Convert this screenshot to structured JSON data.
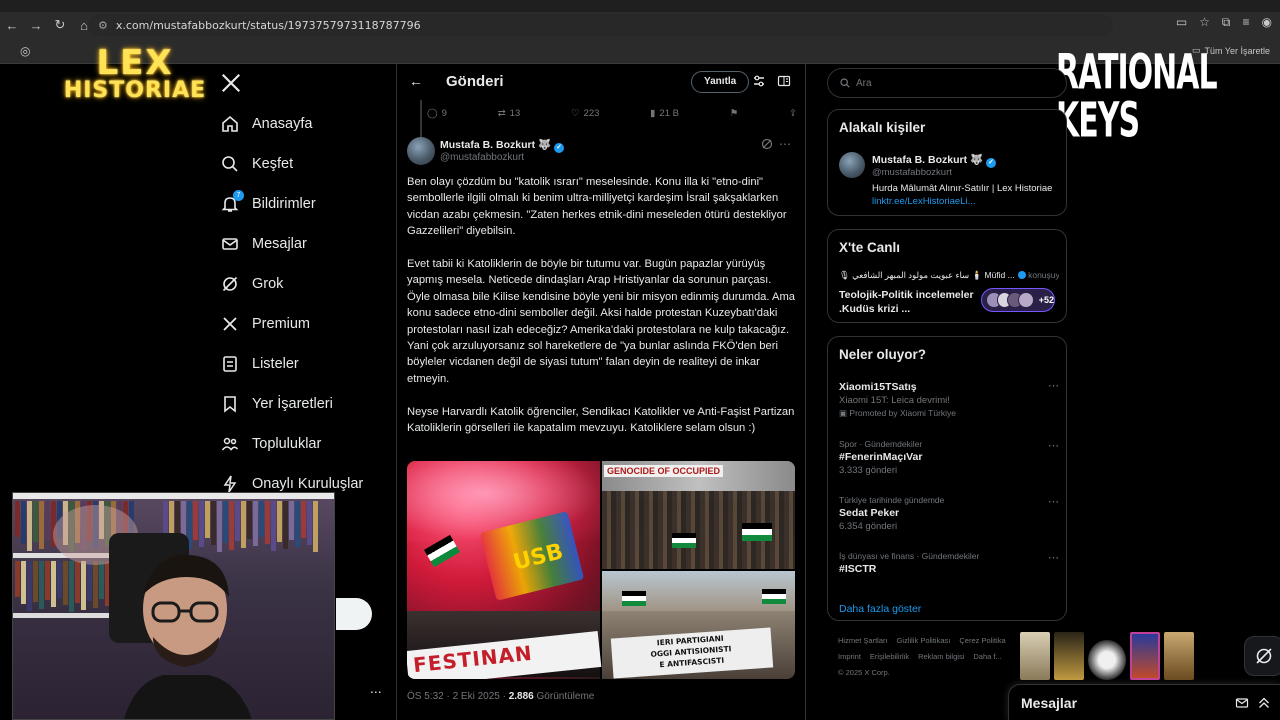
{
  "browser": {
    "url": "x.com/mustafabbozkurt/status/1973757973118787796",
    "bookmark_label": "Tüm Yer İşaretle"
  },
  "logos": {
    "lex_line1": "LEX",
    "lex_line2": "HISTORIAE",
    "rational_keys": "RATIONAL KEYS"
  },
  "nav": {
    "items": [
      {
        "label": "Anasayfa",
        "icon": "home-icon"
      },
      {
        "label": "Keşfet",
        "icon": "search-icon"
      },
      {
        "label": "Bildirimler",
        "icon": "bell-icon"
      },
      {
        "label": "Mesajlar",
        "icon": "mail-icon"
      },
      {
        "label": "Grok",
        "icon": "grok-icon"
      },
      {
        "label": "Premium",
        "icon": "x-icon"
      },
      {
        "label": "Listeler",
        "icon": "list-icon"
      },
      {
        "label": "Yer İşaretleri",
        "icon": "bookmark-icon"
      },
      {
        "label": "Topluluklar",
        "icon": "people-icon"
      },
      {
        "label": "Onaylı Kuruluşlar",
        "icon": "bolt-icon"
      }
    ],
    "notif_badge": "7",
    "bottom_more": "..."
  },
  "header": {
    "title": "Gönderi",
    "reply_label": "Yanıtla"
  },
  "prev_actions": {
    "replies": "9",
    "reposts": "13",
    "likes": "223",
    "views": "21 B"
  },
  "post": {
    "author_name": "Mustafa B. Bozkurt",
    "author_flag": "🐺",
    "author_handle": "@mustafabbozkurt",
    "paragraphs": [
      "Ben olayı çözdüm bu \"katolik ısrarı\" meselesinde. Konu illa ki \"etno-dini\" sembollerle ilgili olmalı ki benim ultra-milliyetçi kardeşim İsrail şakşaklarken vicdan azabı çekmesin. \"Zaten herkes etnik-dini meseleden ötürü destekliyor Gazzelileri\" diyebilsin.",
      "Evet tabii ki Katoliklerin de böyle bir tutumu var. Bugün papazlar yürüyüş yapmış mesela. Neticede dindaşları Arap Hristiyanlar da sorunun parçası. Öyle olmasa bile Kilise kendisine böyle yeni bir misyon edinmiş durumda. Ama konu sadece etno-dini semboller değil. Aksi halde protestan Kuzeybatı'daki protestoları nasıl izah edeceğiz? Amerika'daki protestolara ne kulp takacağız. Yani çok arzuluyorsanız sol hareketlere de \"ya bunlar aslında FKÖ'den beri böyleler vicdanen değil de siyasi tutum\" falan deyin de realiteyi de inkar etmeyin.",
      "Neyse Harvardlı Katolik  öğrenciler, Sendikacı Katolikler ve Anti-Faşist Partizan Katoliklerin görselleri ile kapatalım mevzuyu. Katoliklere selam olsun :)"
    ],
    "image_texts": {
      "img1_banner": "FESTINAN",
      "img1_flag": "USB",
      "img2_sign": "GENOCIDE  OF OCCUPIED",
      "img3_banner_l1": "IERI PARTIGIANI",
      "img3_banner_l2": "OGGI ANTISIONISTI",
      "img3_banner_l3": "E ANTIFASCISTI"
    },
    "time": "ÖS 5:32 · 2 Eki 2025 · ",
    "views_count": "2.886",
    "views_label": " Görüntüleme"
  },
  "right": {
    "search_placeholder": "Ara",
    "related": {
      "title": "Alakalı kişiler",
      "name": "Mustafa B. Bozkurt",
      "flag": "🐺",
      "handle": "@mustafabbozkurt",
      "bio": "Hurda Mâlumât Alınır-Satılır | Lex Historiae ",
      "bio_link": "linktr.ee/LexHistoriaeLi..."
    },
    "live": {
      "title": "X'te Canlı",
      "host": "🎙 ساء عبويت مولود المبهر الشافعي 🕯️ Müfid ...",
      "speaking": " konuşuyor",
      "space_title": "Teolojik-Politik incelemeler .Kudüs krizi ...",
      "plus": "+52"
    },
    "trends": {
      "title": "Neler oluyor?",
      "items": [
        {
          "ctx": "",
          "title": "Xiaomi15TSatış",
          "sub": "Xiaomi 15T: Leica devrimi!",
          "promo": "Promoted by Xiaomi Türkiye"
        },
        {
          "ctx": "Spor · Gündemdekiler",
          "title": "#FenerinMaçıVar",
          "sub": "3.333 gönderi",
          "promo": ""
        },
        {
          "ctx": "Türkiye tarihinde gündemde",
          "title": "Sedat Peker",
          "sub": "6.354 gönderi",
          "promo": ""
        },
        {
          "ctx": "İş dünyası ve finans · Gündemdekiler",
          "title": "#ISCTR",
          "sub": "",
          "promo": ""
        }
      ],
      "show_more": "Daha fazla göster"
    },
    "footer": {
      "links": [
        "Hizmet Şartları",
        "Gizlilik Politikası",
        "Çerez Politika",
        "Imprint",
        "Erişilebilirlik",
        "Reklam bilgisi",
        "Daha f..."
      ],
      "copyright": "© 2025 X Corp."
    }
  },
  "messages_drawer": {
    "title": "Mesajlar"
  },
  "colors": {
    "accent": "#1d9bf0",
    "border": "#2f3336",
    "muted": "#71767b",
    "live_purple": "#7856ff",
    "logo_yellow": "#ffe357"
  }
}
